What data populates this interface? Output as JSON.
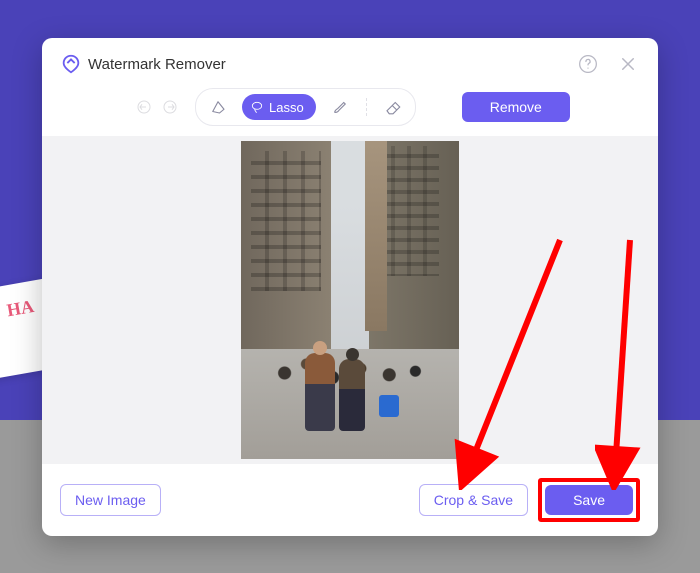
{
  "app": {
    "title": "Watermark Remover"
  },
  "toolbar": {
    "lasso_label": "Lasso",
    "remove_label": "Remove"
  },
  "footer": {
    "new_image_label": "New Image",
    "crop_save_label": "Crop & Save",
    "save_label": "Save"
  },
  "colors": {
    "accent": "#6b5df0",
    "highlight": "#ff0000"
  }
}
